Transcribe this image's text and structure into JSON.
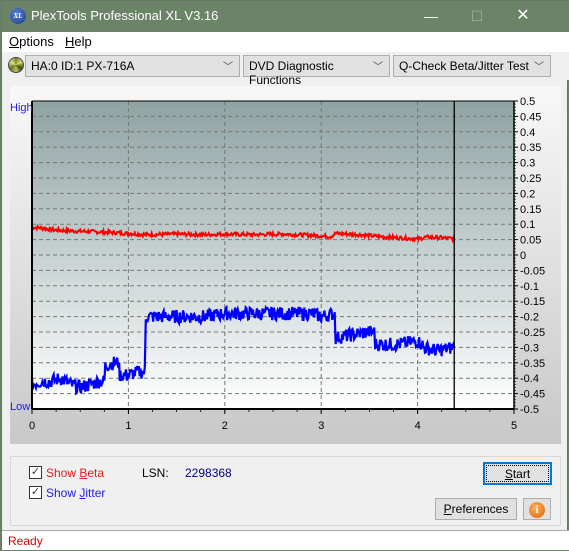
{
  "window": {
    "title": "PlexTools Professional XL V3.16",
    "icon_label": "XL",
    "controls": {
      "minimize": "—",
      "maximize": "☐",
      "close": "✕"
    }
  },
  "menu": {
    "items": [
      {
        "label": "Options",
        "accel": "O",
        "rest": "ptions"
      },
      {
        "label": "Help",
        "accel": "H",
        "rest": "elp"
      }
    ]
  },
  "toolbar": {
    "drive": "HA:0 ID:1  PX-716A",
    "function": "DVD Diagnostic Functions",
    "test": "Q-Check Beta/Jitter Test",
    "chevron": "﹀"
  },
  "chart_data": {
    "type": "line",
    "title": "",
    "xlabel": "",
    "ylabel": "",
    "left_axis_labels": {
      "top": "High",
      "bottom": "Low"
    },
    "xlim": [
      0,
      5
    ],
    "ylim": [
      -0.5,
      0.5
    ],
    "x_ticks": [
      "0",
      "1",
      "2",
      "3",
      "4",
      "5"
    ],
    "y_ticks": [
      "0.5",
      "0.45",
      "0.4",
      "0.35",
      "0.3",
      "0.25",
      "0.2",
      "0.15",
      "0.1",
      "0.05",
      "0",
      "-0.05",
      "-0.1",
      "-0.15",
      "-0.2",
      "-0.25",
      "-0.3",
      "-0.35",
      "-0.4",
      "-0.45",
      "-0.5"
    ],
    "grid": true,
    "marker_x": 4.38,
    "colors": {
      "beta": "#ff0000",
      "jitter": "#0000ff",
      "bg_top": "#8fa3a3",
      "bg_bottom": "#ffffff"
    },
    "series": [
      {
        "name": "Beta",
        "x": [
          0,
          0.1,
          0.2,
          0.3,
          0.5,
          0.7,
          0.9,
          1.0,
          1.2,
          1.5,
          1.8,
          2.0,
          2.3,
          2.6,
          2.9,
          3.0,
          3.1,
          3.15,
          3.4,
          3.6,
          3.8,
          4.0,
          4.1,
          4.2,
          4.38
        ],
        "y": [
          0.09,
          0.088,
          0.082,
          0.08,
          0.077,
          0.075,
          0.072,
          0.07,
          0.066,
          0.068,
          0.066,
          0.068,
          0.066,
          0.068,
          0.064,
          0.062,
          0.06,
          0.07,
          0.066,
          0.06,
          0.056,
          0.052,
          0.058,
          0.057,
          0.053
        ]
      },
      {
        "name": "Jitter",
        "x": [
          0,
          0.1,
          0.2,
          0.3,
          0.4,
          0.5,
          0.6,
          0.7,
          0.75,
          0.76,
          0.85,
          0.9,
          0.91,
          1.0,
          1.1,
          1.17,
          1.18,
          1.3,
          1.5,
          1.8,
          2.0,
          2.3,
          2.6,
          2.9,
          3.0,
          3.14,
          3.15,
          3.3,
          3.5,
          3.55,
          3.56,
          3.8,
          4.0,
          4.05,
          4.06,
          4.2,
          4.38
        ],
        "y": [
          -0.42,
          -0.41,
          -0.41,
          -0.4,
          -0.42,
          -0.43,
          -0.42,
          -0.41,
          -0.41,
          -0.36,
          -0.35,
          -0.35,
          -0.39,
          -0.39,
          -0.38,
          -0.38,
          -0.2,
          -0.2,
          -0.2,
          -0.2,
          -0.19,
          -0.19,
          -0.19,
          -0.19,
          -0.2,
          -0.19,
          -0.27,
          -0.26,
          -0.25,
          -0.25,
          -0.29,
          -0.29,
          -0.28,
          -0.29,
          -0.3,
          -0.31,
          -0.3
        ]
      }
    ]
  },
  "controls": {
    "show_beta": {
      "label_pre": "Show ",
      "accel": "B",
      "label_post": "eta",
      "checked": true
    },
    "show_jitter": {
      "label_pre": "Show ",
      "accel": "J",
      "label_post": "itter",
      "checked": true
    },
    "lsn_label": "LSN:",
    "lsn_value": "2298368",
    "start_button": {
      "accel": "S",
      "rest": "tart"
    },
    "preferences_button": {
      "accel": "P",
      "rest": "references"
    },
    "info_icon": "i",
    "checkmark": "✓"
  },
  "status": {
    "text": "Ready"
  }
}
